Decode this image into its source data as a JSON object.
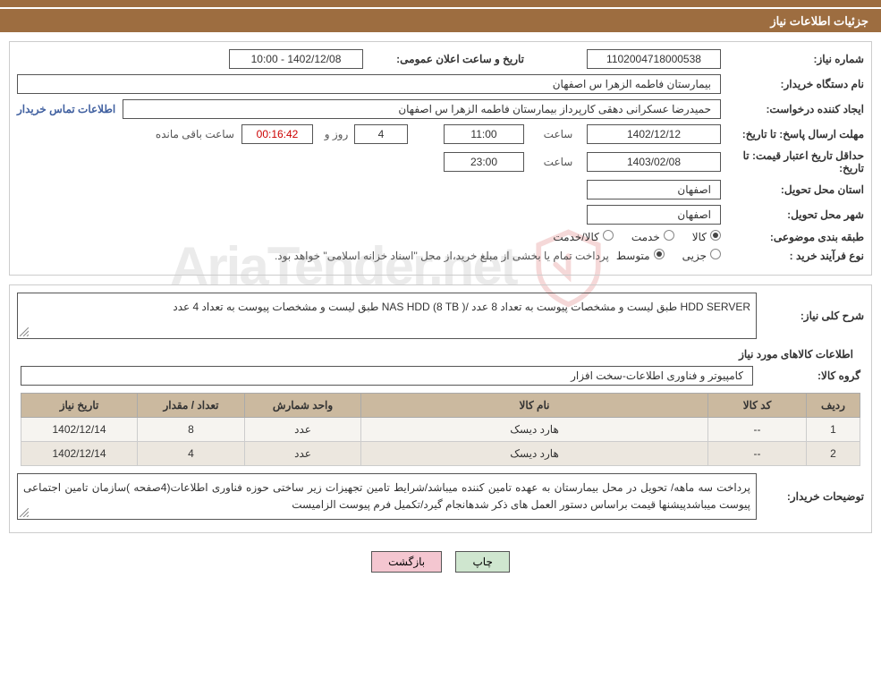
{
  "header": {
    "title": "جزئیات اطلاعات نیاز"
  },
  "labels": {
    "need_no": "شماره نیاز:",
    "announce": "تاریخ و ساعت اعلان عمومی:",
    "buyer_org": "نام دستگاه خریدار:",
    "requester": "ایجاد کننده درخواست:",
    "buyer_contact": "اطلاعات تماس خریدار",
    "reply_deadline": "مهلت ارسال پاسخ:",
    "to_date": "تا تاریخ:",
    "hour": "ساعت",
    "days_and": "روز و",
    "time_left": "ساعت باقی مانده",
    "price_validity": "حداقل تاریخ اعتبار قیمت:",
    "delivery_province": "استان محل تحویل:",
    "delivery_city": "شهر محل تحویل:",
    "classification": "طبقه بندی موضوعی:",
    "goods": "کالا",
    "service": "خدمت",
    "goods_service": "کالا/خدمت",
    "purchase_type": "نوع فرآیند خرید :",
    "partial": "جزیی",
    "medium": "متوسط",
    "payment_note": "پرداخت تمام یا بخشی از مبلغ خرید،از محل \"اسناد خزانه اسلامی\" خواهد بود.",
    "general_desc": "شرح کلی نیاز:",
    "items_title": "اطلاعات کالاهای مورد نیاز",
    "goods_group": "گروه کالا:",
    "buyer_notes": "توضیحات خریدار:"
  },
  "values": {
    "need_no": "1102004718000538",
    "announce": "1402/12/08 - 10:00",
    "buyer_org": "بیمارستان فاطمه الزهرا س اصفهان",
    "requester": "حمیدرضا عسکرانی دهقی کارپرداز بیمارستان فاطمه الزهرا س اصفهان",
    "reply_date": "1402/12/12",
    "reply_time": "11:00",
    "days_left": "4",
    "counter": "00:16:42",
    "price_validity_date": "1403/02/08",
    "price_validity_time": "23:00",
    "province": "اصفهان",
    "city": "اصفهان",
    "general_desc": "HDD SERVER طبق لیست و مشخصات پیوست به تعداد 8 عدد /( NAS HDD (8 TB طبق لیست و مشخصات پیوست به تعداد 4 عدد",
    "goods_group": "کامپیوتر و فناوری اطلاعات-سخت افزار",
    "buyer_notes": "پرداخت سه ماهه/ تحویل در محل بیمارستان به عهده تامین کننده میباشد/شرایط تامین تجهیزات زیر ساختی حوزه فناوری اطلاعات(4صفحه )سازمان تامین اجتماعی پیوست میباشدپیشنها قیمت براساس دستور العمل های ذکر شدهانجام گیرد/تکمیل فرم پیوست الزامیست"
  },
  "table": {
    "headers": {
      "row": "ردیف",
      "code": "کد کالا",
      "name": "نام کالا",
      "unit": "واحد شمارش",
      "qty": "تعداد / مقدار",
      "need_date": "تاریخ نیاز"
    },
    "rows": [
      {
        "row": "1",
        "code": "--",
        "name": "هارد دیسک",
        "unit": "عدد",
        "qty": "8",
        "need_date": "1402/12/14"
      },
      {
        "row": "2",
        "code": "--",
        "name": "هارد دیسک",
        "unit": "عدد",
        "qty": "4",
        "need_date": "1402/12/14"
      }
    ]
  },
  "buttons": {
    "print": "چاپ",
    "back": "بازگشت"
  },
  "watermark": "AriaTender.net"
}
